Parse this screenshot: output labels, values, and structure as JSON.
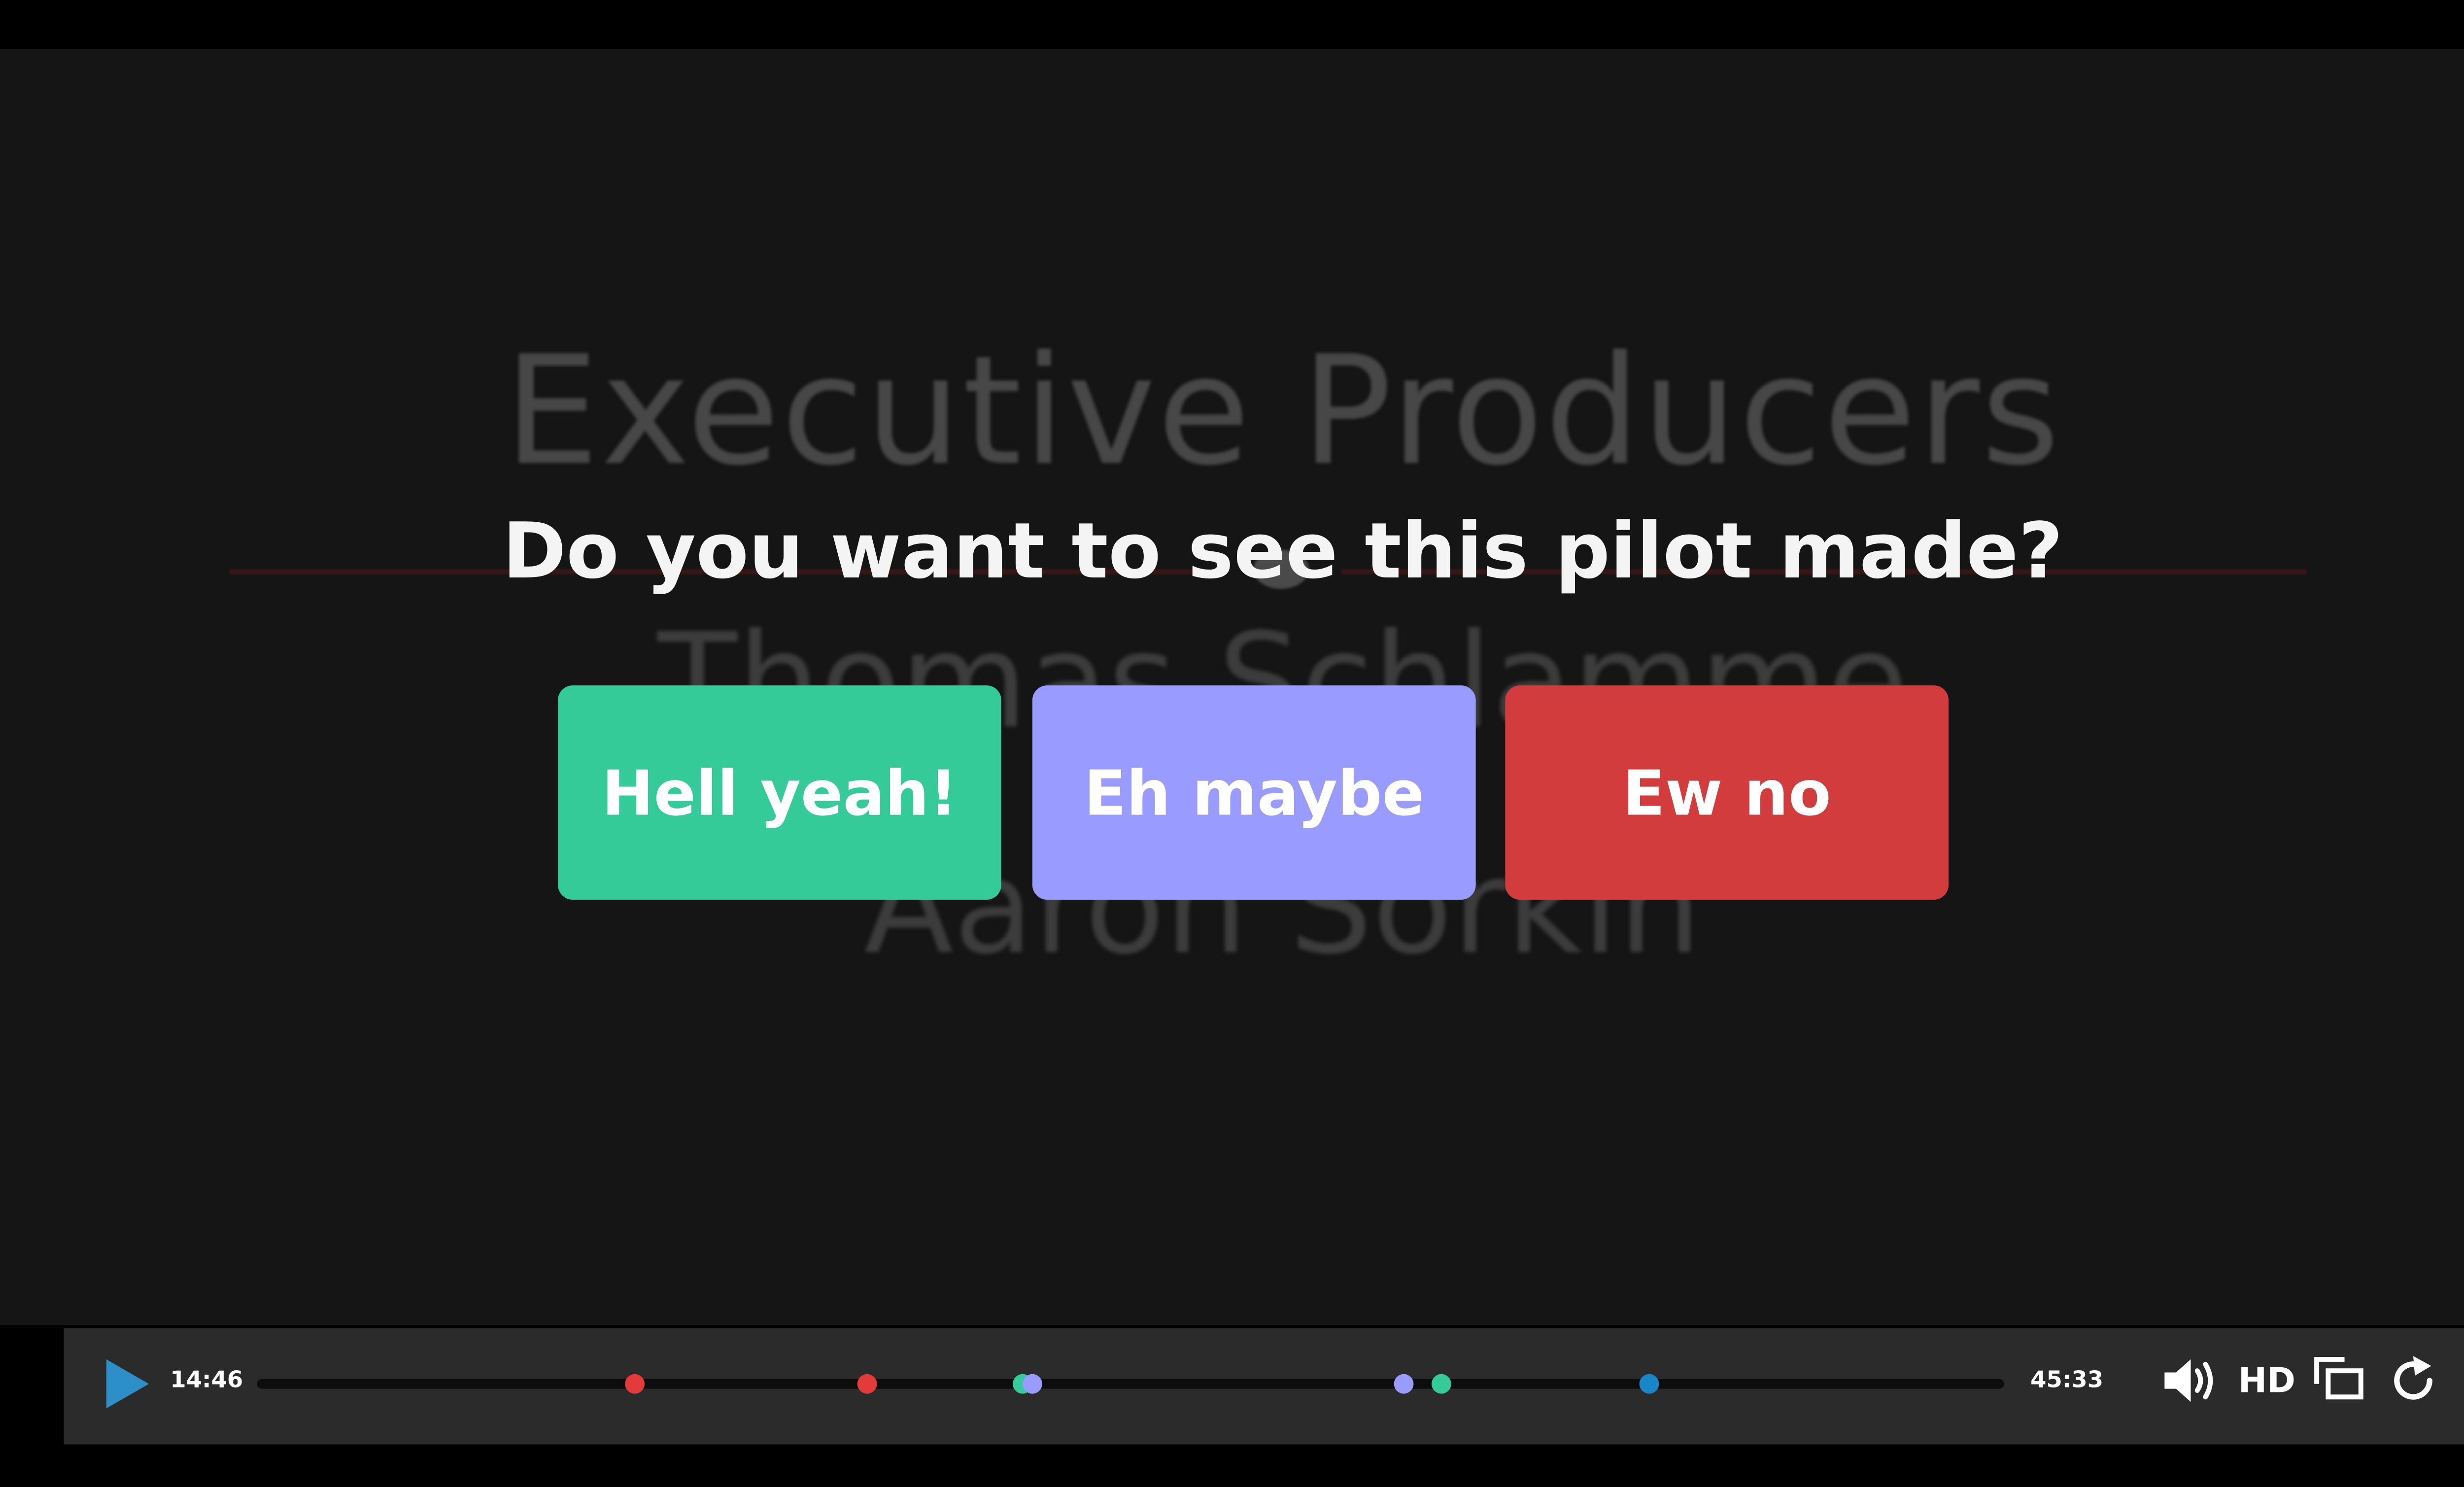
{
  "video": {
    "background_credits": {
      "title": "Executive Producers",
      "name_line_1": "Thomas Schlamme",
      "name_line_2": "Aaron Sorkin"
    }
  },
  "poll": {
    "question": "Do you want to see this pilot made?",
    "choices": [
      {
        "label": "Hell yeah!",
        "color": "#34cb98"
      },
      {
        "label": "Eh maybe",
        "color": "#9a9bfe"
      },
      {
        "label": "Ew no",
        "color": "#d33c3c"
      }
    ]
  },
  "player": {
    "current_time": "14:46",
    "total_time": "45:33",
    "quality_label": "HD",
    "accent_color": "#2d8fc7",
    "icons": [
      "play-icon",
      "volume-icon",
      "fullscreen-icon",
      "replay-icon"
    ],
    "progress_fraction": 0,
    "vote_markers": [
      {
        "time_fraction": 0.216,
        "color": "#e33a3a"
      },
      {
        "time_fraction": 0.349,
        "color": "#e33a3a"
      },
      {
        "time_fraction": 0.438,
        "color": "#34cb98"
      },
      {
        "time_fraction": 0.444,
        "color": "#9a9bfe"
      },
      {
        "time_fraction": 0.656,
        "color": "#9a9bfe"
      },
      {
        "time_fraction": 0.678,
        "color": "#34cb98"
      },
      {
        "time_fraction": 0.797,
        "color": "#1a86c8"
      }
    ]
  }
}
